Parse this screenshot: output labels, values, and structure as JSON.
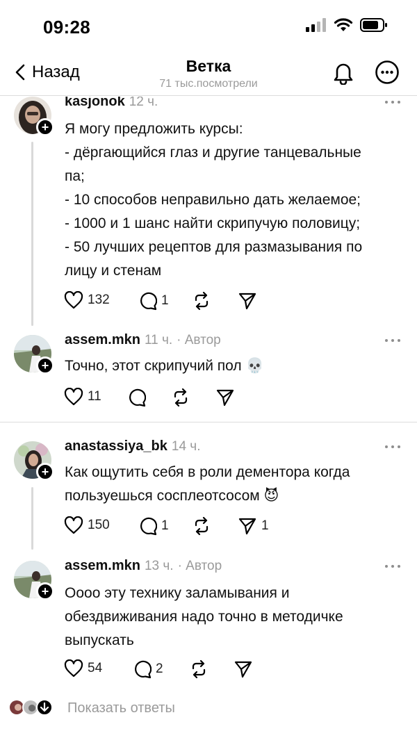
{
  "status": {
    "time": "09:28"
  },
  "nav": {
    "back_label": "Назад",
    "title": "Ветка",
    "subtitle": "71 тыс.посмотрели"
  },
  "posts": [
    {
      "username": "kasjonok",
      "time": "12 ч.",
      "author_tag": "",
      "lines": [
        "Я могу предложить курсы:",
        "- дёргающийся глаз и другие танцевальные",
        "па;",
        "- 10 способов неправильно дать желаемое;",
        "- 1000 и 1 шанс найти скрипучую половицу;",
        "- 50 лучших рецептов для размазывания по",
        "лицу и стенам"
      ],
      "likes": "132",
      "replies": "1",
      "reposts": "",
      "shares": ""
    },
    {
      "username": "assem.mkn",
      "time": "11 ч.",
      "author_tag": "· Автор",
      "lines": [
        "Точно, этот скрипучий пол 💀"
      ],
      "likes": "11",
      "replies": "",
      "reposts": "",
      "shares": ""
    },
    {
      "username": "anastassiya_bk",
      "time": "14 ч.",
      "author_tag": "",
      "lines": [
        "Как ощутить себя в роли дементора когда",
        "пользуешься сосплеотсосом 😈"
      ],
      "likes": "150",
      "replies": "1",
      "reposts": "",
      "shares": "1"
    },
    {
      "username": "assem.mkn",
      "time": "13 ч.",
      "author_tag": "· Автор",
      "lines": [
        "Оооо эту технику заламывания и",
        "обездвиживания надо точно в методичке",
        "выпускать"
      ],
      "likes": "54",
      "replies": "2",
      "reposts": "",
      "shares": ""
    }
  ],
  "footer": {
    "show_replies_label": "Показать ответы"
  },
  "icons": [
    "chevron-left-icon",
    "bell-icon",
    "more-circle-icon",
    "heart-icon",
    "comment-icon",
    "repost-icon",
    "share-icon",
    "more-dots-icon",
    "plus-icon",
    "arrow-down-icon"
  ]
}
